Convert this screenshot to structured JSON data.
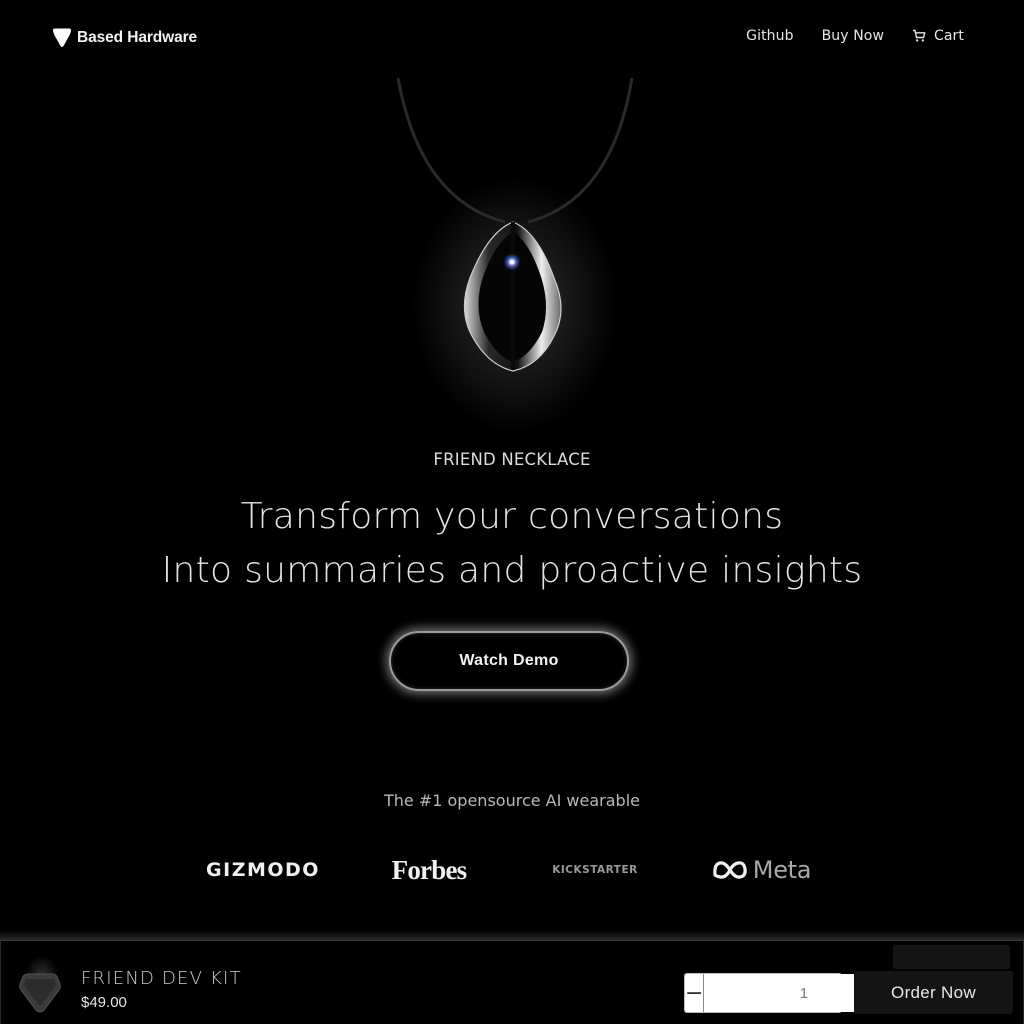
{
  "header": {
    "brand": "Based Hardware",
    "brand_icon": "shield-heart-logo-icon",
    "nav": [
      {
        "label": "Github"
      },
      {
        "label": "Buy Now"
      },
      {
        "label": "Cart",
        "icon": "cart-icon"
      }
    ]
  },
  "hero": {
    "image_alt": "Friend necklace pendant with glowing blue LED",
    "led_color": "#3a5cff",
    "eyebrow": "FRIEND NECKLACE",
    "headline_line1": "Transform your conversations",
    "headline_line2": "Into summaries and proactive insights",
    "cta_label": "Watch Demo"
  },
  "press": {
    "tagline": "The #1 opensource AI wearable",
    "logos": [
      "GIZMODO",
      "Forbes",
      "KICKSTARTER",
      "Meta"
    ]
  },
  "purchase_bar": {
    "product_name": "FRIEND DEV KIT",
    "price": "$49.00",
    "quantity": "1",
    "decrement_label": "−",
    "increment_label": "+",
    "order_label": "Order Now"
  }
}
